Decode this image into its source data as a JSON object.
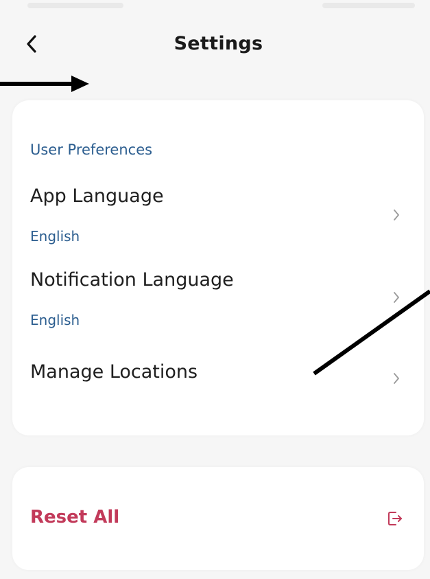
{
  "header": {
    "title": "Settings",
    "back_icon": "chevron-left-icon"
  },
  "preferences": {
    "section_heading": "User Preferences",
    "items": [
      {
        "title": "App Language",
        "value": "English",
        "icon": "chevron-right-icon"
      },
      {
        "title": "Notification Language",
        "value": "English",
        "icon": "chevron-right-icon"
      },
      {
        "title": "Manage Locations",
        "icon": "chevron-right-icon"
      }
    ]
  },
  "reset": {
    "label": "Reset All",
    "icon": "logout-icon"
  },
  "colors": {
    "background": "#f6f6f6",
    "card": "#ffffff",
    "accent_blue": "#2b5d8f",
    "reset_red": "#c23a5a",
    "text_primary": "#1f1f1f",
    "chevron_gray": "#9a9a9a"
  }
}
